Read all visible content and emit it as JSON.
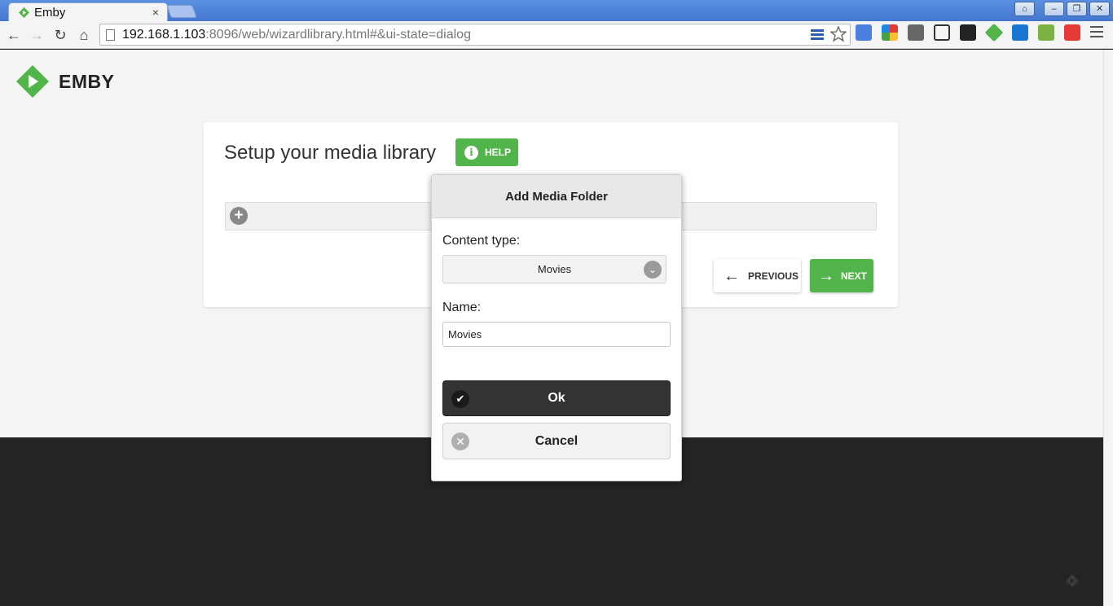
{
  "browser": {
    "tab_title": "Emby",
    "tab_close": "×",
    "url_host": "192.168.1.103",
    "url_rest": ":8096/web/wizardlibrary.html#&ui-state=dialog",
    "window_buttons": [
      "⌂",
      "–",
      "❐",
      "✕"
    ]
  },
  "brand": {
    "name": "EMBY",
    "accent": "#52b54b"
  },
  "wizard": {
    "title": "Setup your media library",
    "help_label": "HELP",
    "previous_label": "PREVIOUS",
    "next_label": "NEXT"
  },
  "dialog": {
    "title": "Add Media Folder",
    "content_type_label": "Content type:",
    "content_type_value": "Movies",
    "name_label": "Name:",
    "name_value": "Movies",
    "ok_label": "Ok",
    "cancel_label": "Cancel"
  },
  "colors": {
    "accent": "#52b54b",
    "dark_bg": "#242424",
    "light_bg": "#f4f4f4"
  }
}
